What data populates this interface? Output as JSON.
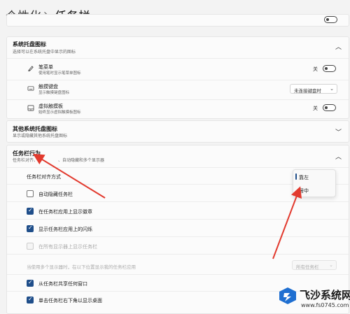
{
  "breadcrumb": {
    "root": "个性化",
    "separator": "›",
    "current": "任务栏"
  },
  "tray_icons": {
    "title": "系统托盘图标",
    "subtitle": "选择可以在系统托盘中显示的图标",
    "items": [
      {
        "title": "笔菜单",
        "subtitle": "使用笔时显示笔菜单图标",
        "icon": "pen-icon",
        "control": "toggle",
        "state": "关"
      },
      {
        "title": "触摸键盘",
        "subtitle": "显示触摸键盘图标",
        "icon": "keyboard-icon",
        "control": "dropdown",
        "value": "未连接键盘时"
      },
      {
        "title": "虚拟触摸板",
        "subtitle": "始终显示虚拟触摸板图标",
        "icon": "touchpad-icon",
        "control": "toggle",
        "state": "关"
      }
    ]
  },
  "other_tray": {
    "title": "其他系统托盘图标",
    "subtitle": "显示或隐藏其他系统托盘图标"
  },
  "behaviors": {
    "title": "任务栏行为",
    "subtitle_left": "任务栏对齐、",
    "subtitle_right": "、自动隐藏和多个显示器",
    "alignment_label": "任务栏对齐方式",
    "alignment_options": [
      "靠左",
      "居中"
    ],
    "alignment_selected": "靠左",
    "auto_hide": "自动隐藏任务栏",
    "show_badges": "在任务栏应用上显示徽章",
    "show_flashing": "显示任务栏应用上的闪烁",
    "all_displays": "在所有显示器上显示任务栏",
    "multi_display_label": "当使用多个显示器时，在以下位置显示我的任务栏应用",
    "multi_display_value": "所有任务栏",
    "share_window": "从任务栏共享任何窗口",
    "show_desktop": "单击任务栏右下角以显示桌面"
  },
  "watermark": {
    "title": "飞沙系统网",
    "url": "www.fs0745.com"
  },
  "colors": {
    "accent": "#1f4e8a",
    "arrow": "#e23a2e"
  }
}
